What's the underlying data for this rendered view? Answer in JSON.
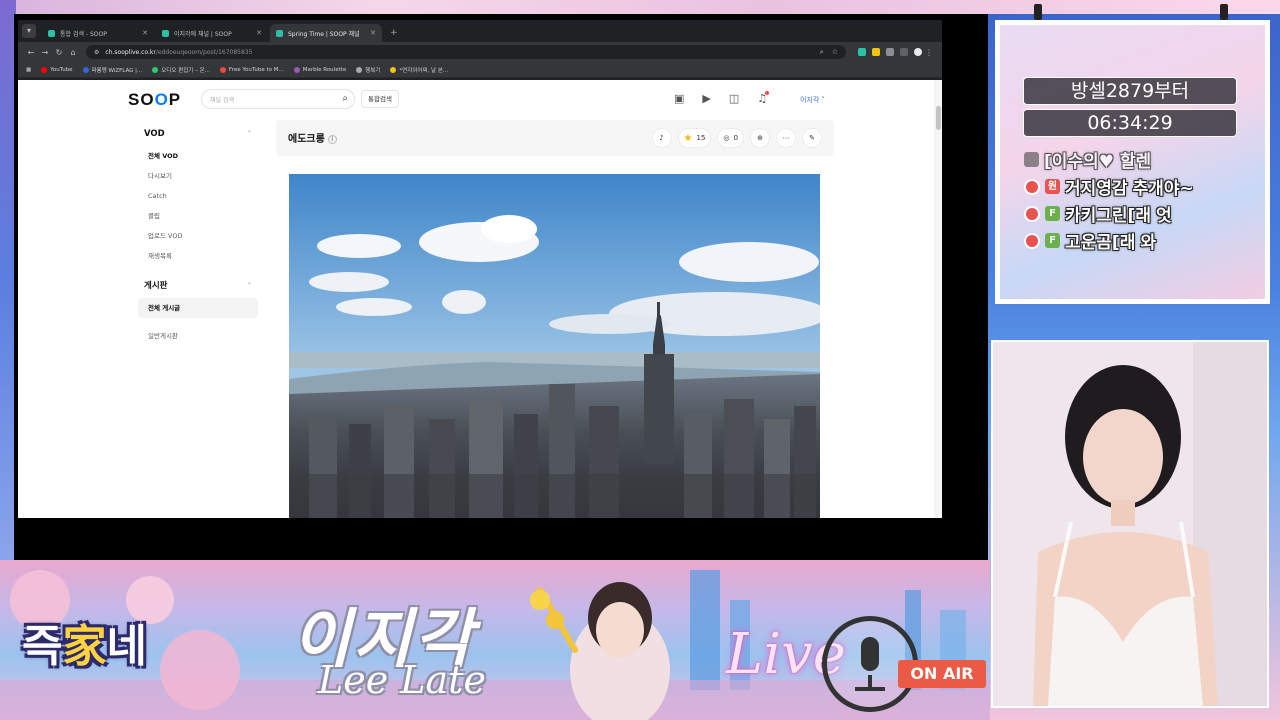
{
  "browser": {
    "tabs": [
      {
        "label": "통합 검색 - SOOP",
        "active": false
      },
      {
        "label": "이지각에 채널 | SOOP",
        "active": false
      },
      {
        "label": "Spring Time | SOOP 채널",
        "active": true
      }
    ],
    "address": {
      "host": "ch.sooplive.co.kr",
      "path": "/eddoeuqeoom/post/167085835"
    },
    "bookmarks": [
      {
        "label": "YouTube",
        "color": "#ff0000"
      },
      {
        "label": "파룡맹 WiZFLAG |...",
        "color": "#3367d6"
      },
      {
        "label": "오디오 편집기 – 온...",
        "color": "#2ecc71"
      },
      {
        "label": "Free YouTube to M...",
        "color": "#e74c3c"
      },
      {
        "label": "Marble Roulette",
        "color": "#9b59b6"
      },
      {
        "label": "행복기",
        "color": "#aaaaaa"
      },
      {
        "label": "*연지이어쩌, 날 본...",
        "color": "#f1c40f"
      }
    ]
  },
  "site": {
    "logo": {
      "prefix": "SO",
      "accent": "O",
      "suffix": "P"
    },
    "search_placeholder": "채널 검색",
    "total_search_label": "통합검색",
    "user_menu": "이지각 ˅"
  },
  "sidebar": {
    "vod": {
      "title": "VOD",
      "items": [
        "전체 VOD",
        "다시보기",
        "Catch",
        "클립",
        "업로드 VOD",
        "재생목록"
      ]
    },
    "board": {
      "title": "게시판",
      "items": [
        "전체 게시글",
        "일반게시판"
      ]
    }
  },
  "content": {
    "channel_title": "에도크롱",
    "info_glyph": "i",
    "star_count": "15",
    "comment_count": "0"
  },
  "overlay": {
    "pill_text": "방셀2879부터",
    "timer": "06:34:29",
    "chat": [
      {
        "user": "[이수의♥ 할렌",
        "message": ""
      },
      {
        "badge": "원",
        "user": "거지영감",
        "message": "추개야~"
      },
      {
        "badge": "F",
        "user": "카키그린[래",
        "message": "엇"
      },
      {
        "badge": "F",
        "user": "고운곰[래",
        "message": "와"
      }
    ]
  },
  "banner": {
    "mascot_a": "즉",
    "mascot_b": "家",
    "mascot_c": "네",
    "name_kr": "이지각",
    "name_en": "Lee Late",
    "live": "Live",
    "on_air": "ON AIR"
  },
  "colors": {
    "accent": "#0a7cff",
    "onair": "#ea5a44",
    "star": "#f5b800"
  }
}
